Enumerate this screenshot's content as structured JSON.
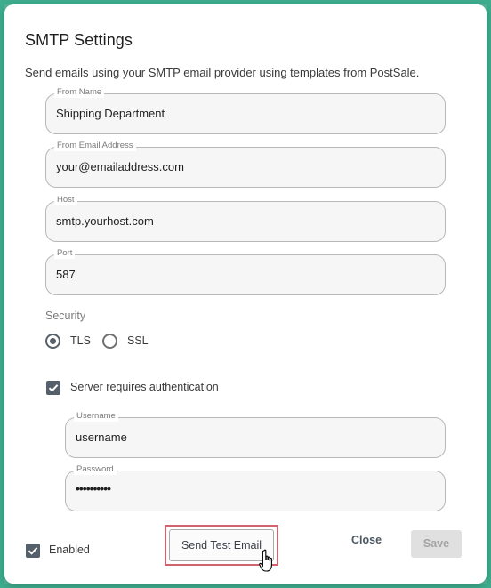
{
  "dialog": {
    "title": "SMTP Settings",
    "description": "Send emails using your SMTP email provider using templates from PostSale."
  },
  "fields": {
    "from_name": {
      "label": "From Name",
      "value": "Shipping Department"
    },
    "from_email": {
      "label": "From Email Address",
      "value": "your@emailaddress.com"
    },
    "host": {
      "label": "Host",
      "value": "smtp.yourhost.com"
    },
    "port": {
      "label": "Port",
      "value": "587"
    },
    "username": {
      "label": "Username",
      "value": "username"
    },
    "password": {
      "label": "Password",
      "value": "••••••••••"
    }
  },
  "security": {
    "label": "Security",
    "options": [
      {
        "label": "TLS",
        "selected": true
      },
      {
        "label": "SSL",
        "selected": false
      }
    ]
  },
  "auth": {
    "label": "Server requires authentication",
    "checked": true
  },
  "footer": {
    "enabled_label": "Enabled",
    "enabled_checked": true,
    "test_button": "Send Test Email",
    "close_button": "Close",
    "save_button": "Save"
  },
  "colors": {
    "accent": "#55606a",
    "highlight_border": "#d0636e",
    "backdrop": "#3fae8f"
  },
  "icons": {
    "cursor": "hand-pointer-icon",
    "check": "checkmark-icon"
  }
}
